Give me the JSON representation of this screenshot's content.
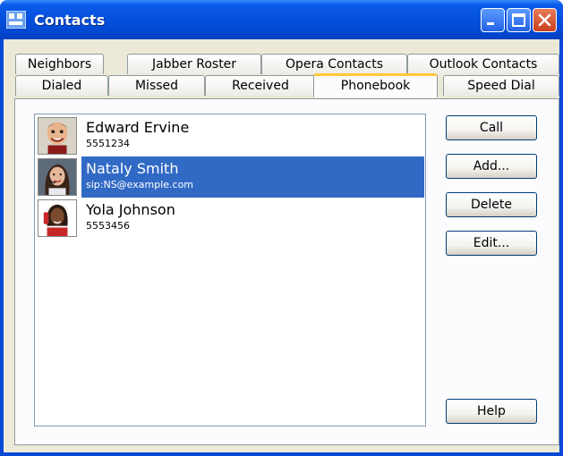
{
  "window": {
    "title": "Contacts"
  },
  "tabs_back": [
    {
      "label": "Neighbors"
    },
    {
      "label": "Jabber Roster"
    },
    {
      "label": "Opera Contacts"
    },
    {
      "label": "Outlook Contacts"
    }
  ],
  "tabs_front": [
    {
      "label": "Dialed"
    },
    {
      "label": "Missed"
    },
    {
      "label": "Received"
    },
    {
      "label": "Phonebook",
      "active": true
    },
    {
      "label": "Speed Dial"
    }
  ],
  "contacts": [
    {
      "name": "Edward Ervine",
      "detail": "5551234",
      "avatar": "cartoon-man-avatar"
    },
    {
      "name": "Nataly Smith",
      "detail": "sip:NS@example.com",
      "avatar": "woman-headset-avatar",
      "selected": true
    },
    {
      "name": "Yola Johnson",
      "detail": "5553456",
      "avatar": "woman-phone-avatar"
    }
  ],
  "buttons": {
    "call": "Call",
    "add": "Add...",
    "delete": "Delete",
    "edit": "Edit...",
    "help": "Help"
  },
  "colors": {
    "titlebar": "#0550dc",
    "selection": "#316ac5",
    "active_tab_accent": "#ffc83c",
    "close_button": "#c9401c"
  },
  "icons": [
    "app-icon",
    "minimize-icon",
    "maximize-icon",
    "close-icon"
  ]
}
